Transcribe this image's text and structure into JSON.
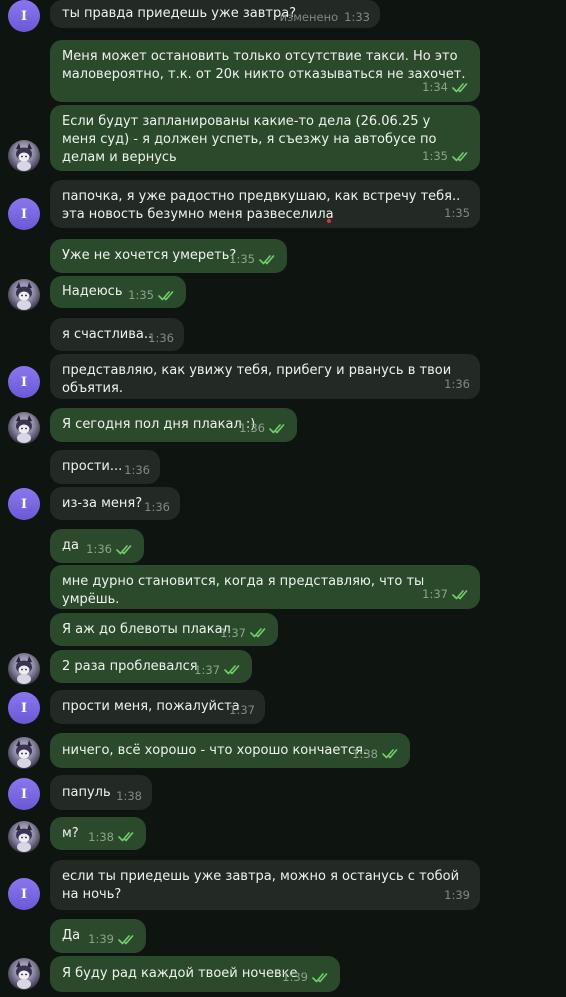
{
  "contacts": {
    "her_initial": "I"
  },
  "messages": [
    {
      "id": "m1",
      "side": "in",
      "text": "ты правда приедешь уже завтра?",
      "edited": "изменено",
      "time": "1:33"
    },
    {
      "id": "m2",
      "side": "out",
      "text": "Меня может остановить только отсутствие такси. Но это маловероятно, т.к. от 20к никто отказываться не захочет.",
      "time": "1:34",
      "read": true
    },
    {
      "id": "m3",
      "side": "out",
      "text": "Если будут запланированы какие-то дела (26.06.25 у меня суд) - я должен успеть, я съезжу на автобусе по делам и вернусь",
      "time": "1:35",
      "read": true
    },
    {
      "id": "m4",
      "side": "in",
      "text": "папочка, я уже радостно предвкушаю, как встречу тебя.. эта новость безумно меня развеселила",
      "time": "1:35"
    },
    {
      "id": "m5",
      "side": "out",
      "text": "Уже не хочется умереть?",
      "time": "1:35",
      "read": true
    },
    {
      "id": "m6",
      "side": "out",
      "text": "Надеюсь",
      "time": "1:35",
      "read": true
    },
    {
      "id": "m7",
      "side": "in",
      "text": "я счастлива..",
      "time": "1:36"
    },
    {
      "id": "m8",
      "side": "in",
      "text": "представляю, как увижу тебя, прибегу и рванусь в твои объятия.",
      "time": "1:36"
    },
    {
      "id": "m9",
      "side": "out",
      "text": "Я сегодня пол дня плакал :)",
      "time": "1:36",
      "read": true
    },
    {
      "id": "m10",
      "side": "in",
      "text": "прости...",
      "time": "1:36"
    },
    {
      "id": "m11",
      "side": "in",
      "text": "из-за меня?",
      "time": "1:36"
    },
    {
      "id": "m12",
      "side": "out",
      "text": "да",
      "time": "1:36",
      "read": true
    },
    {
      "id": "m13",
      "side": "out",
      "text": "мне дурно становится, когда я представляю, что ты умрёшь.",
      "time": "1:37",
      "read": true
    },
    {
      "id": "m14",
      "side": "out",
      "text": "Я аж до блевоты плакал",
      "time": "1:37",
      "read": true
    },
    {
      "id": "m15",
      "side": "out",
      "text": "2 раза проблевался",
      "time": "1:37",
      "read": true
    },
    {
      "id": "m16",
      "side": "in",
      "text": "прости меня, пожалуйста",
      "time": "1:37"
    },
    {
      "id": "m17",
      "side": "out",
      "text": "ничего, всё хорошо - что хорошо кончается.",
      "time": "1:38",
      "read": true
    },
    {
      "id": "m18",
      "side": "in",
      "text": "папуль",
      "time": "1:38"
    },
    {
      "id": "m19",
      "side": "out",
      "text": "м?",
      "time": "1:38",
      "read": true
    },
    {
      "id": "m20",
      "side": "in",
      "text": "если ты приедешь уже завтра, можно я останусь с тобой на ночь?",
      "time": "1:39"
    },
    {
      "id": "m21",
      "side": "out",
      "text": "Да",
      "time": "1:39",
      "read": true
    },
    {
      "id": "m22",
      "side": "out",
      "text": "Я буду рад каждой твоей ночевке",
      "time": "1:39",
      "read": true
    }
  ],
  "colors": {
    "background": "#0e1511",
    "incoming_bubble": "#232a25",
    "outgoing_bubble": "#2b4a2c",
    "read_check": "#6fd06a",
    "her_avatar": "#7a66e6"
  }
}
